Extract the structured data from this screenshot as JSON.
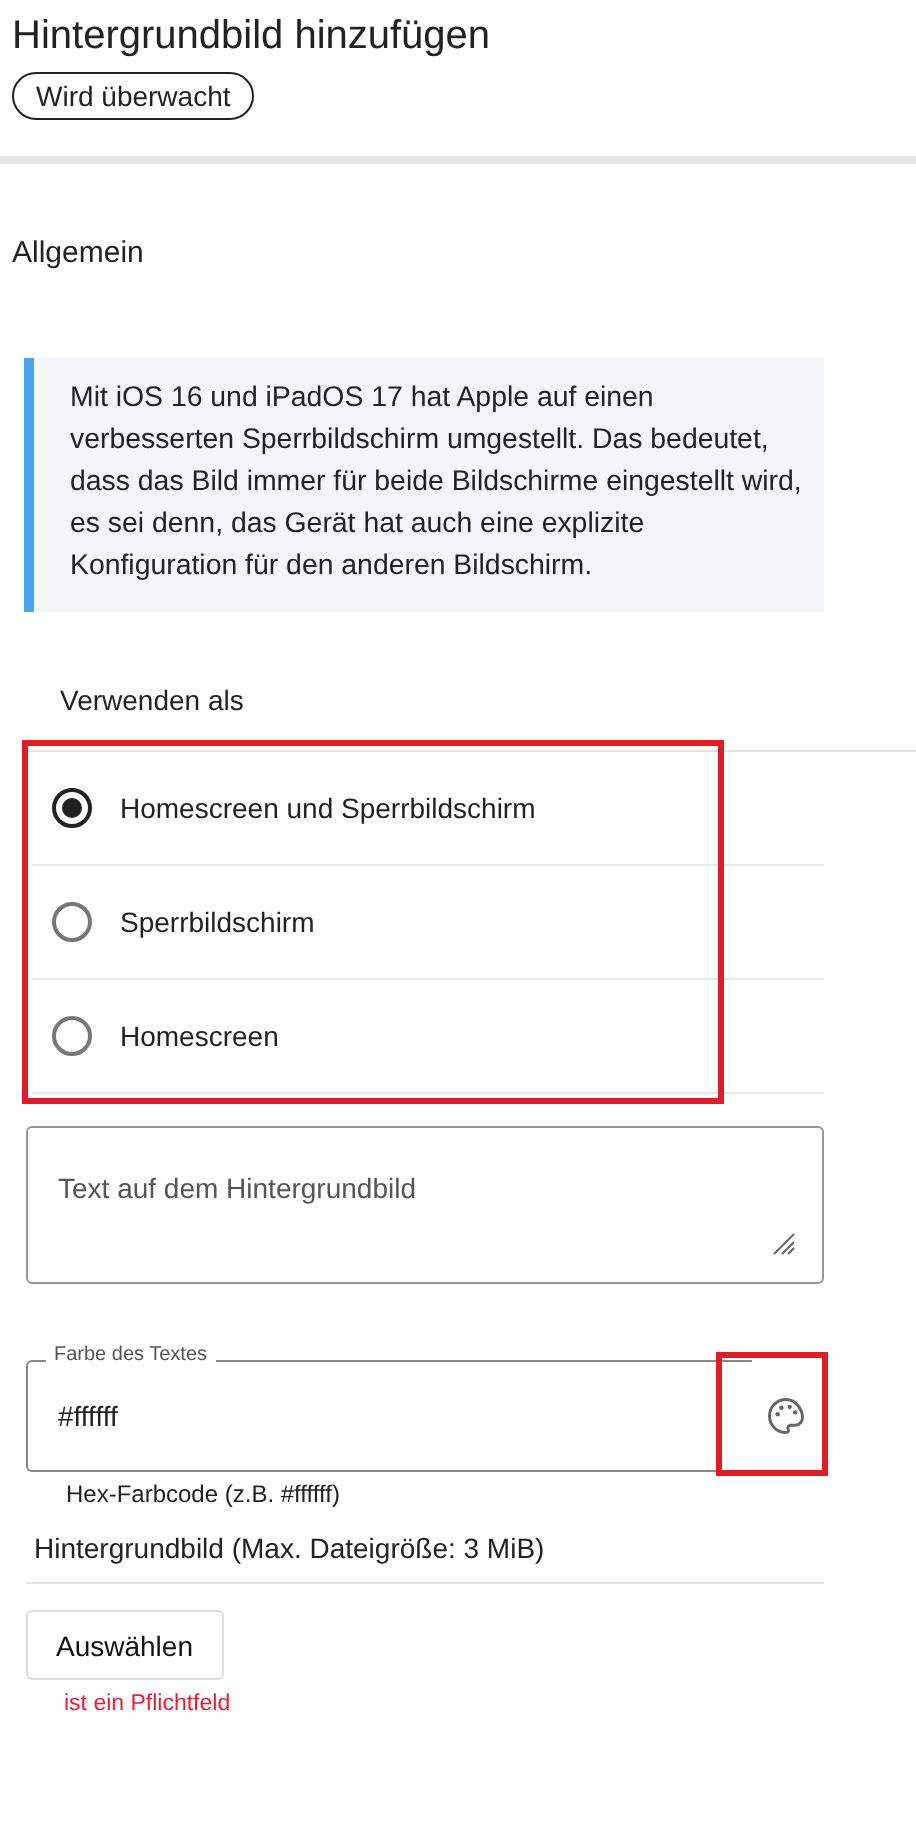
{
  "title": "Hintergrundbild hinzufügen",
  "status_chip": "Wird überwacht",
  "section": "Allgemein",
  "info": "Mit iOS 16 und iPadOS 17 hat Apple auf einen verbesserten Sperrbildschirm umgestellt. Das bedeutet, dass das Bild immer für beide Bildschirme eingestellt wird, es sei denn, das Gerät hat auch eine explizite Konfiguration für den anderen Bildschirm.",
  "usage": {
    "label": "Verwenden als",
    "highlighted": true,
    "options": [
      {
        "label": "Homescreen und Sperrbildschirm",
        "selected": true
      },
      {
        "label": "Sperrbildschirm",
        "selected": false
      },
      {
        "label": "Homescreen",
        "selected": false
      }
    ]
  },
  "text_field": {
    "placeholder": "Text auf dem Hintergrundbild"
  },
  "color_field": {
    "label": "Farbe des Textes",
    "value": "#ffffff",
    "hint": "Hex-Farbcode (z.B. #ffffff)",
    "picker_highlighted": true
  },
  "upload": {
    "label": "Hintergrundbild (Max. Dateigröße: 3 MiB)",
    "button": "Auswählen",
    "error": "ist ein Pflichtfeld"
  }
}
